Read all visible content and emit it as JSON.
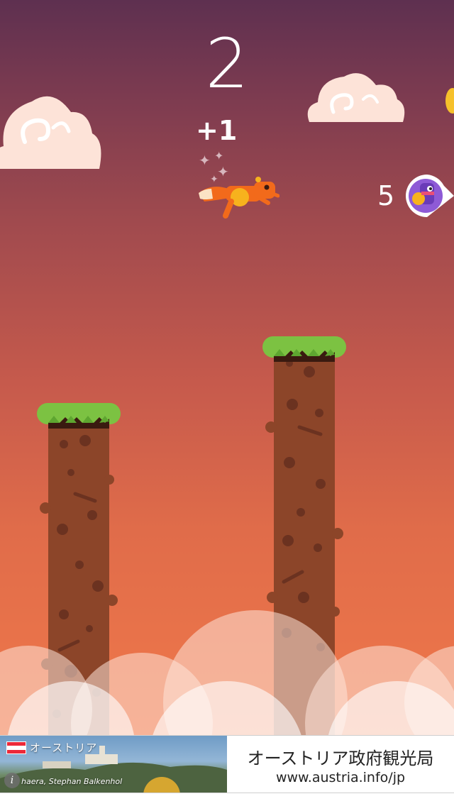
{
  "hud": {
    "score": "2",
    "bonus_popup": "+1",
    "rival_count": "5"
  },
  "icons": {
    "player": "fox-character",
    "rival": "purple-creature-avatar",
    "coin": "gold-coin",
    "info": "info-icon",
    "flag": "austria-flag"
  },
  "colors": {
    "sky_top": "#5e3050",
    "sky_bottom": "#f0784a",
    "grass": "#7cc242",
    "dirt": "#8c4529",
    "fox_orange": "#f26a1b",
    "fox_yellow": "#f7b21d",
    "cloud": "#fde3d8"
  },
  "ad": {
    "country_label": "オーストリア",
    "photo_credit": "haera, Stephan Balkenhol",
    "info_symbol": "i",
    "title": "オーストリア政府観光局",
    "url": "www.austria.info/jp"
  }
}
